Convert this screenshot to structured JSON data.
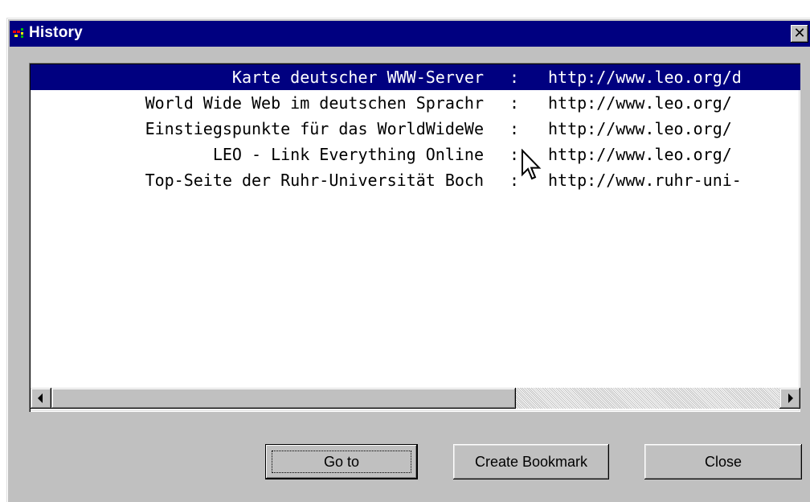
{
  "window": {
    "title": "History",
    "close_glyph": "✕"
  },
  "history": {
    "separator": ":",
    "rows": [
      {
        "title": "Karte deutscher WWW-Server",
        "url": "http://www.leo.org/d",
        "selected": true
      },
      {
        "title": "World Wide Web im deutschen Sprachr",
        "url": "http://www.leo.org/",
        "selected": false
      },
      {
        "title": "Einstiegspunkte für das WorldWideWe",
        "url": "http://www.leo.org/",
        "selected": false
      },
      {
        "title": "LEO - Link Everything Online",
        "url": "http://www.leo.org/",
        "selected": false
      },
      {
        "title": "Top-Seite der Ruhr-Universität Boch",
        "url": "http://www.ruhr-uni-",
        "selected": false
      }
    ]
  },
  "buttons": {
    "goto": "Go to",
    "bookmark": "Create Bookmark",
    "close": "Close"
  },
  "colors": {
    "title_bar": "#000080",
    "selection": "#000080",
    "face": "#c0c0c0"
  }
}
